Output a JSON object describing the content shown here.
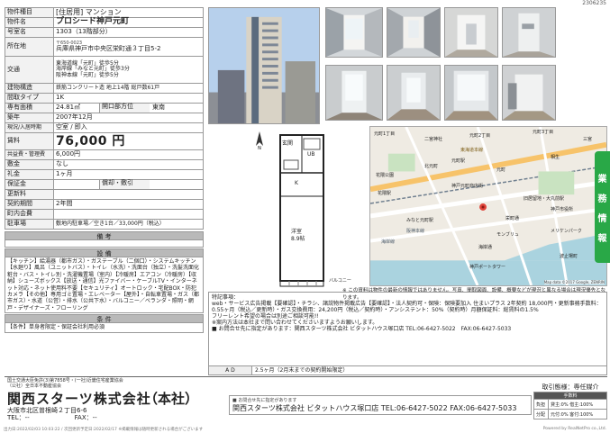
{
  "page_id": "2306235",
  "property": {
    "type_label": "物件種目",
    "type_value": "[住居用] マンション",
    "name_label": "物件名",
    "name_value": "プロシード神戸元町",
    "room_label": "号室名",
    "room_value": "1303（13階部分）",
    "loc_label": "所在地",
    "loc_zip": "〒650-0023",
    "loc_value": "兵庫県神戸市中央区栄町通３丁目5-2",
    "traffic_label": "交通",
    "traffic_lines": [
      "東海道線「元町」徒歩5分",
      "海岸線「みなと元町」徒歩3分",
      "阪神本線「元町」徒歩5分"
    ],
    "structure_label": "建物構造",
    "structure_value": "鉄筋コンクリート造 地上14階 総戸数61戸",
    "layout_label": "間取タイプ",
    "layout_value": "1K",
    "area_label": "専有面積",
    "area_value": "24.81㎡",
    "opening_label": "開口部方位",
    "opening_value": "東南",
    "built_label": "築年",
    "built_value": "2007年12月",
    "status_label": "現況/入居時期",
    "status_value": "空室 / 即入",
    "rent_label": "賃料",
    "rent_value": "76,000 円",
    "fee_label": "共益費・管理費",
    "fee_value": "6,000円",
    "deposit_label": "敷金",
    "deposit_value": "なし",
    "key_label": "礼金",
    "key_value": "1ヶ月",
    "guarantee_label": "保証金",
    "guarantee_value": "",
    "amort_label": "償却・敷引",
    "amort_value": "",
    "renewal_label": "更新料",
    "renewal_value": "",
    "contract_label": "契約期間",
    "contract_value": "2年間",
    "insurance_label": "町内会費",
    "insurance_value": "",
    "parking_label": "駐車場",
    "parking_value": "敷地内駐車場／空き1台／33,000円（税込）"
  },
  "sections": {
    "remarks_title": "備 考",
    "equipment_title": "設 備",
    "equipment_text": "【キッチン】給湯器（都市ガス）・ガステーブル（二個口）・システムキッチン【水廻り】風呂（ユニットバス）・トイレ（水洗）・洗面台（独立）・洗髪洗面化粧台・バス・トイレ別・洗濯機置場（室内）【冷暖房】エアコン（冷暖房）【収納】シューズボックス【放送・通信】光ファイバー・ケーブルTV・インターネット対応・ネット使用料不要【セキュリティ】オートロック・宅配BOX・防犯カメラ【その他】専用ゴミ置場・エレベーター【屋外】・自転車置場・ガス（都市ガス）・水道（公営）・排水（公共下水）・バルコニー／ベランダ・照明・網戸・デザイナーズ・フローリング",
    "conditions_title": "条 件",
    "conditions_text": "【条件】単身者限定・保証会社利用必須"
  },
  "floorplan": {
    "bath_label": "UB",
    "entrance_label": "玄関",
    "room_label": "洋室",
    "room_size": "8.9帖",
    "kitchen_label": "K",
    "balcony_label": "バルコニー"
  },
  "map": {
    "labels": [
      "元町1丁目",
      "二宮神社",
      "元町2丁目",
      "元町3丁目",
      "花隈公園",
      "相生",
      "北元町",
      "元町",
      "神戸元町商店街",
      "栄町通",
      "海岸通",
      "三宮",
      "波止場町",
      "阪神本線",
      "海岸線",
      "東海道本線",
      "花隈駅",
      "元町駅",
      "旧居留地・大丸前駅",
      "みなと元町駅",
      "神戸ポートタワー",
      "神戸市役所",
      "メリケンパーク",
      "モンブリュ"
    ],
    "copyright": "Map data ©2017 Google, ZENRIN"
  },
  "map_note": "※ この資料は物件の最新の情報ではありません。写真、間取図面、設備、概要などが現況と異なる場合は現況優先となります。",
  "remarks": {
    "heading": "特記事項：",
    "lines": [
      "web・サービス広告掲載【要確認】・チラシ、諸説物件掲載広告【要確認】・法人契約可・保険：保険要加入 住まいプラス 2年契約 18,000円・更新事務手数料：0.55ヶ月（税込／更新時）・ガス交換費用：24,200円（税込／契約時）・アンシステント：50%（契約時）月額保証料：総賃料の1.5%",
      "フリーレント希望の場合は別途ご相談可能!!",
      "※案内方法は本社まで問い合わせてくださいますようお願いします。",
      "■ お問合せ先に指定があります：関西スターツ株式会社 ビタットハウス塚口店 TEL:06-6427-5022　FAX:06-6427-5033"
    ],
    "ad_label": "A  D",
    "ad_value": "2.5ヶ月（2月末までの契約開始限定）"
  },
  "side_tab": [
    "業",
    "務",
    "情",
    "報"
  ],
  "footer": {
    "license_lines": [
      "国土交通大臣免許(3)第7858号・(一社)近畿住宅産業協会",
      "（公社）全日本不動産協会"
    ],
    "company": "関西スターツ株式会社",
    "branch": "（本社）",
    "address": "大阪市北区曽根崎２丁目6-6",
    "tel": "TEL：--",
    "fax": "FAX：--",
    "broker_note": "■ お問合せ先に指定があります",
    "broker": "関西スターツ株式会社 ビタットハウス塚口店 TEL:06-6427-5022  FAX:06-6427-5033",
    "deal_title": "取引態様：専任媒介",
    "deal_header": "手数料",
    "deal_rows": [
      [
        "負担",
        "貸主:0% 借主:100%"
      ],
      [
        "分配",
        "元付:0% 客付:100%"
      ]
    ],
    "bottom_left": "出力日:2022/02/03 10:03:22 / 次回更新予定日:2022/02/17 ※掲載情報は随時更新される場合がございます",
    "bottom_right": "Powered by RealNetPro co.,Ltd."
  }
}
